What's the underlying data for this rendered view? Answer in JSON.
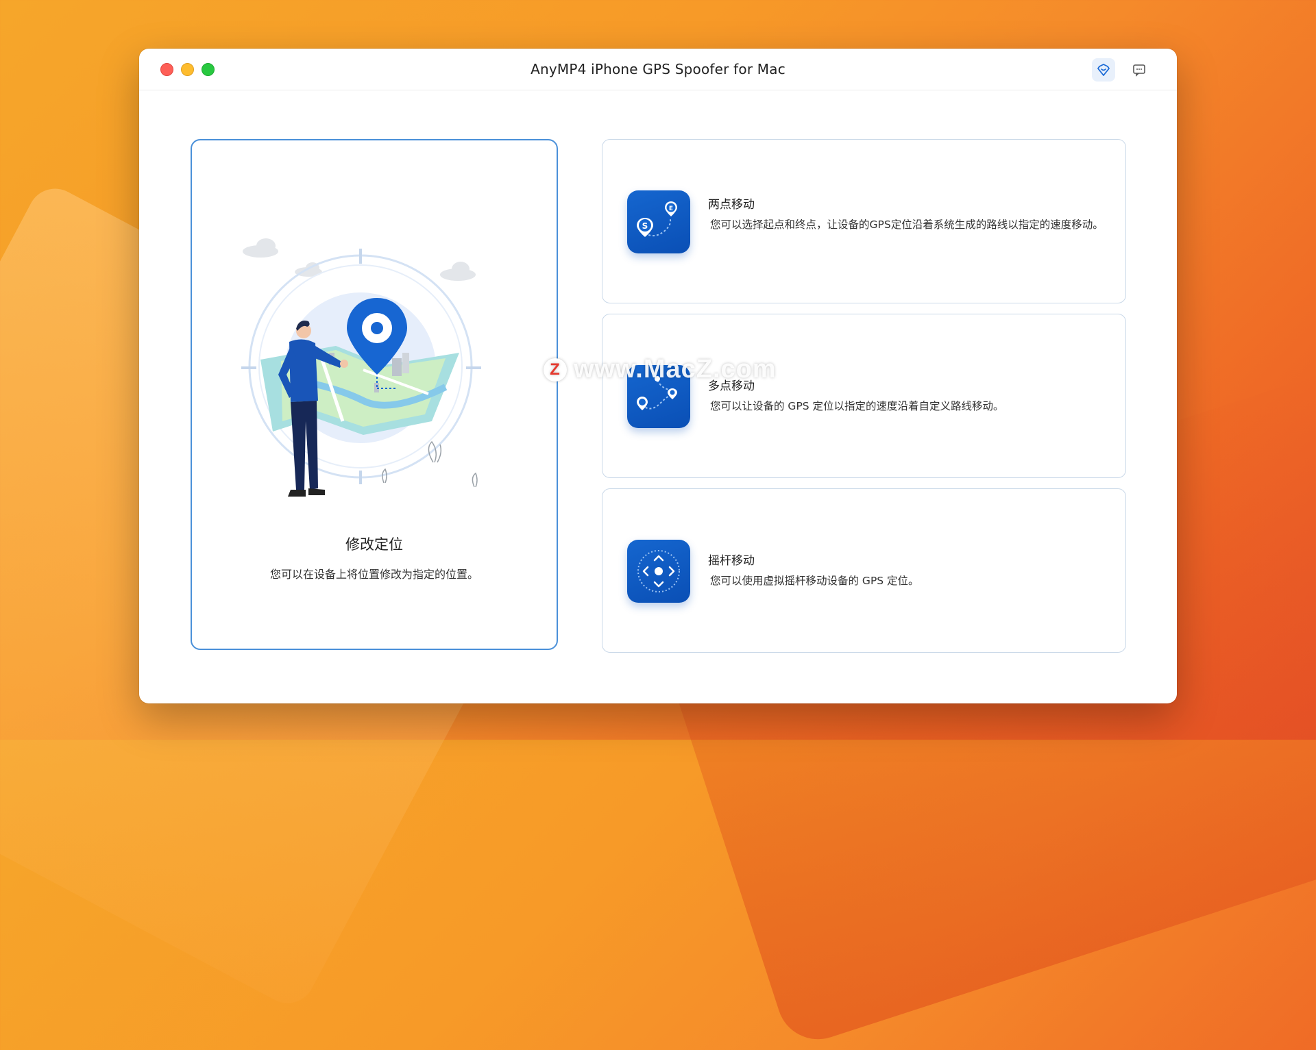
{
  "window": {
    "title": "AnyMP4 iPhone GPS Spoofer for Mac"
  },
  "titlebar_icons": [
    "diamond-heart-icon",
    "message-icon"
  ],
  "main_card": {
    "title": "修改定位",
    "description": "您可以在设备上将位置修改为指定的位置。"
  },
  "features": [
    {
      "title": "两点移动",
      "description": "您可以选择起点和终点，让设备的GPS定位沿着系统生成的路线以指定的速度移动。",
      "icon": "two-point-route-icon"
    },
    {
      "title": "多点移动",
      "description": "您可以让设备的 GPS 定位以指定的速度沿着自定义路线移动。",
      "icon": "multi-point-route-icon"
    },
    {
      "title": "摇杆移动",
      "description": "您可以使用虚拟摇杆移动设备的 GPS 定位。",
      "icon": "joystick-icon"
    }
  ],
  "watermark": {
    "logo_letter": "Z",
    "text": "www.MacZ.com"
  },
  "colors": {
    "accent": "#1566cf",
    "selected_border": "#4a90d9",
    "card_border": "#c9d8e8"
  }
}
